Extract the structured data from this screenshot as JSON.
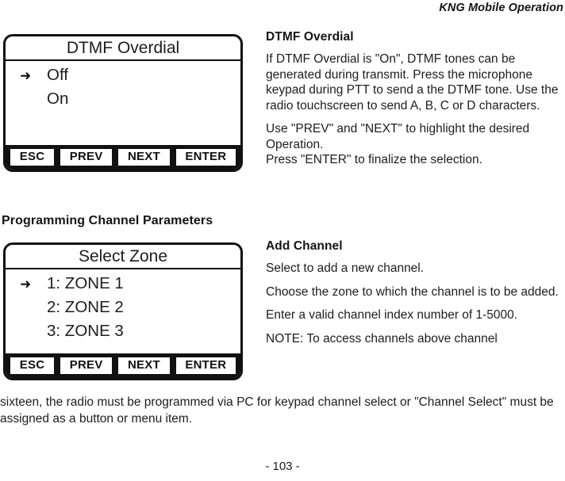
{
  "header": {
    "running_title": "KNG Mobile Operation"
  },
  "screens": [
    {
      "id": "dtmf",
      "title": "DTMF Overdial",
      "marker_icon": "right-arrow-icon",
      "marker_glyph": "➜",
      "items": [
        {
          "label": "Off",
          "selected": true
        },
        {
          "label": "On",
          "selected": false
        }
      ],
      "softkeys": [
        "ESC",
        "PREV",
        "NEXT",
        "ENTER"
      ]
    },
    {
      "id": "zone",
      "title": "Select Zone",
      "marker_icon": "right-arrow-icon",
      "marker_glyph": "➜",
      "items": [
        {
          "label": "1: ZONE 1",
          "selected": true
        },
        {
          "label": "2: ZONE 2",
          "selected": false
        },
        {
          "label": "3: ZONE 3",
          "selected": false
        }
      ],
      "softkeys": [
        "ESC",
        "PREV",
        "NEXT",
        "ENTER"
      ]
    }
  ],
  "descriptions": {
    "dtmf": {
      "heading": "DTMF Overdial",
      "paragraph_1": "If DTMF Overdial is \"On\", DTMF tones can be generated during transmit. Press the microphone keypad during PTT to send a the DTMF tone. Use the radio touchscreen to send A, B, C or D characters.",
      "paragraph_2": "Use \"PREV\" and \"NEXT\" to highlight the desired Operation.\nPress \"ENTER\" to finalize the selection."
    },
    "add_channel": {
      "heading": "Add Channel",
      "paragraph_1": "Select to add a new channel.",
      "paragraph_2": "Choose the zone to which the channel is to be added.",
      "paragraph_3": "Enter a valid channel index number of 1-5000.",
      "paragraph_4": "NOTE: To access channels above channel"
    }
  },
  "section_heading": "Programming Channel Parameters",
  "note_overflow": "sixteen, the radio must be programmed via PC for keypad channel select or \"Channel Select\" must be assigned as a button or menu item.",
  "footer": {
    "page_number": "- 103 -"
  }
}
